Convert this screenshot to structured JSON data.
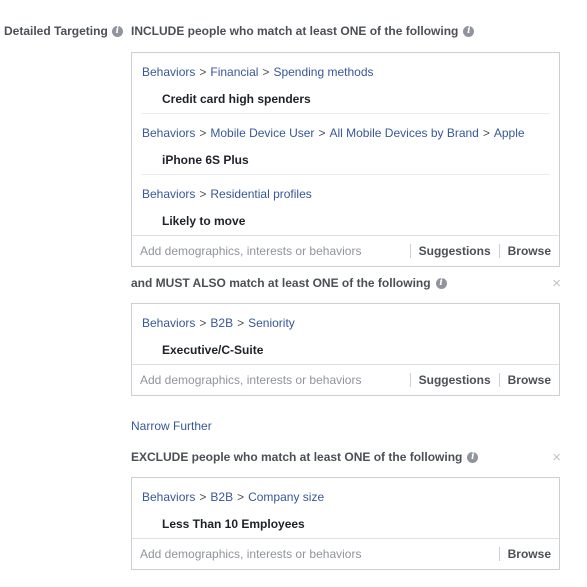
{
  "detailed_targeting": {
    "label": "Detailed Targeting"
  },
  "include": {
    "heading": "INCLUDE people who match at least ONE of the following",
    "groups": [
      {
        "path": [
          "Behaviors",
          "Financial",
          "Spending methods"
        ],
        "item": "Credit card high spenders"
      },
      {
        "path": [
          "Behaviors",
          "Mobile Device User",
          "All Mobile Devices by Brand",
          "Apple"
        ],
        "item": "iPhone 6S Plus"
      },
      {
        "path": [
          "Behaviors",
          "Residential profiles"
        ],
        "item": "Likely to move"
      }
    ],
    "placeholder": "Add demographics, interests or behaviors",
    "suggestions": "Suggestions",
    "browse": "Browse"
  },
  "must_also": {
    "heading": "and MUST ALSO match at least ONE of the following",
    "groups": [
      {
        "path": [
          "Behaviors",
          "B2B",
          "Seniority"
        ],
        "item": "Executive/C-Suite"
      }
    ],
    "placeholder": "Add demographics, interests or behaviors",
    "suggestions": "Suggestions",
    "browse": "Browse"
  },
  "narrow_further": "Narrow Further",
  "exclude": {
    "heading": "EXCLUDE people who match at least ONE of the following",
    "groups": [
      {
        "path": [
          "Behaviors",
          "B2B",
          "Company size"
        ],
        "item": "Less Than 10 Employees"
      }
    ],
    "placeholder": "Add demographics, interests or behaviors",
    "browse": "Browse"
  },
  "icons": {
    "info": "i",
    "close": "×",
    "separator": ">"
  }
}
